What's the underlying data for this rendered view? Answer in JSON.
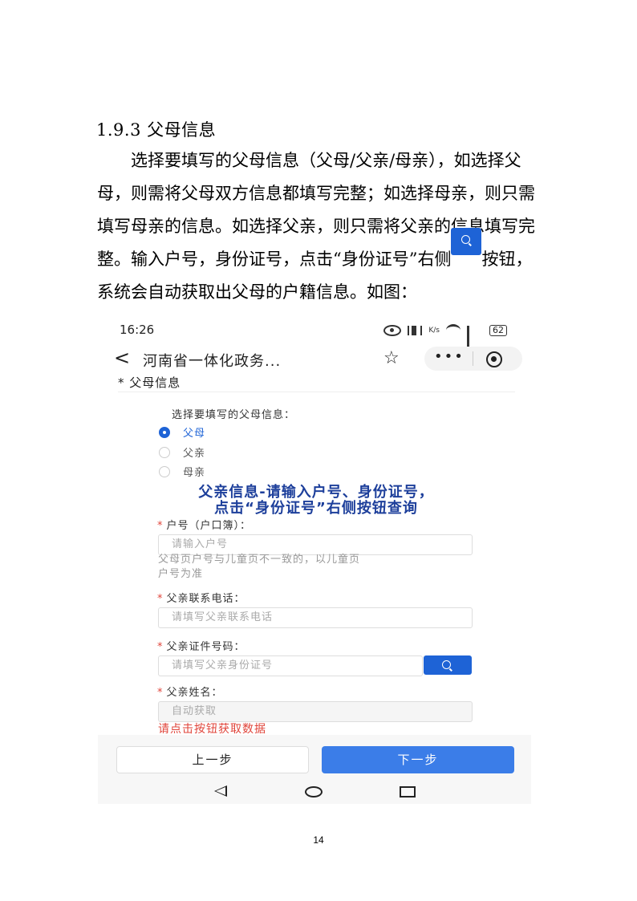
{
  "heading": "1.9.3 父母信息",
  "paragraph": {
    "line1": "选择要填写的父母信息（父母/父亲/母亲），如选择父",
    "line2": "母，则需将父母双方信息都填写完整；如选择母亲，则只需",
    "line3": "填写母亲的信息。如选择父亲，则只需将父亲的信息填写完",
    "line4_before": "整。输入户号，身份证号，点击“身份证号”右侧",
    "line4_after": "按钮，",
    "line5": "系统会自动获取出父母的户籍信息。如图："
  },
  "phone": {
    "status": {
      "time": "16:26",
      "battery": "62",
      "speed": "K/s"
    },
    "nav": {
      "back": "<",
      "title": "河南省一体化政务...",
      "star": "☆",
      "more": "•••"
    },
    "section_title": "* 父母信息",
    "choose_label": "选择要填写的父母信息：",
    "radios": [
      {
        "label": "父母",
        "selected": true
      },
      {
        "label": "父亲",
        "selected": false
      },
      {
        "label": "母亲",
        "selected": false
      }
    ],
    "banner_line1": "父亲信息-请输入户号、身份证号，",
    "banner_line2": "点击“身份证号”右侧按钮查询",
    "fields": {
      "hukou": {
        "label": "户号（户口簿）：",
        "placeholder": "请输入户号",
        "hint_line1": "父母页户号与儿童页不一致的，以儿童页",
        "hint_line2": "户号为准"
      },
      "phone": {
        "label": "父亲联系电话：",
        "placeholder": "请填写父亲联系电话"
      },
      "id": {
        "label": "父亲证件号码：",
        "placeholder": "请填写父亲身份证号"
      },
      "name": {
        "label": "父亲姓名：",
        "placeholder": "自动获取"
      }
    },
    "required_mark": "*",
    "error": "请点击按钮获取数据",
    "buttons": {
      "prev": "上一步",
      "next": "下一步"
    },
    "accent": "#1e63d6"
  },
  "page_number": "14"
}
